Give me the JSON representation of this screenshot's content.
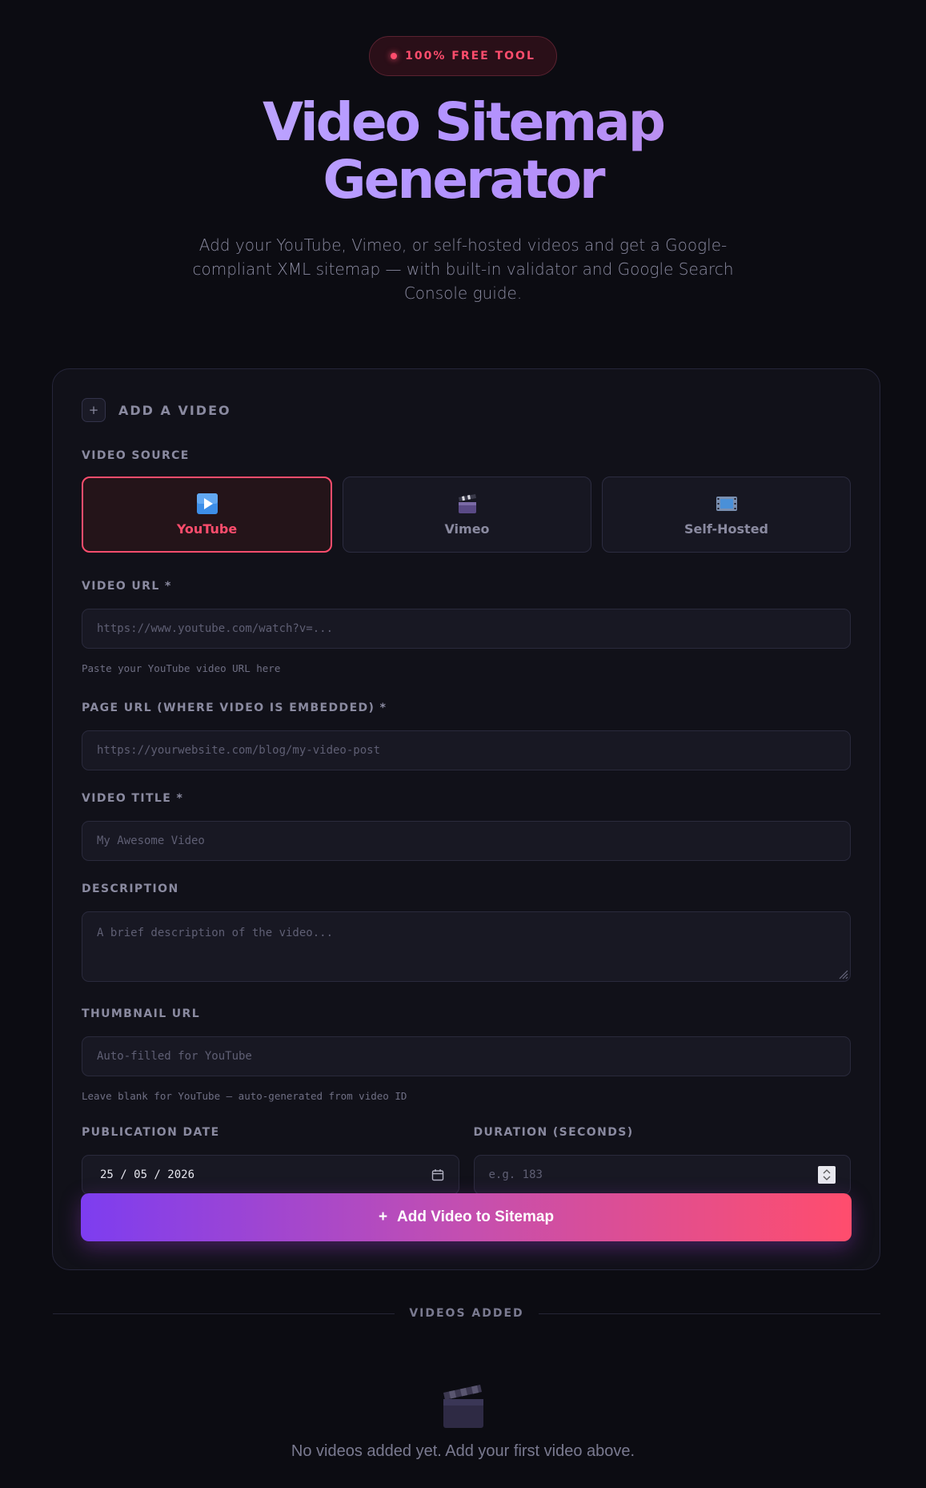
{
  "badge": {
    "text": "100% FREE TOOL"
  },
  "hero": {
    "title_line1": "Video Sitemap",
    "title_line2": "Generator",
    "subtitle": "Add your YouTube, Vimeo, or self-hosted videos and get a Google-compliant XML sitemap — with built-in validator and Google Search Console guide."
  },
  "form": {
    "heading": "ADD A VIDEO",
    "source_label": "VIDEO SOURCE",
    "sources": [
      {
        "name": "YouTube",
        "icon": "play-button-icon",
        "active": true
      },
      {
        "name": "Vimeo",
        "icon": "clapper-board-icon",
        "active": false
      },
      {
        "name": "Self-Hosted",
        "icon": "film-strip-icon",
        "active": false
      }
    ],
    "video_url": {
      "label": "VIDEO URL *",
      "placeholder": "https://www.youtube.com/watch?v=...",
      "hint": "Paste your YouTube video URL here"
    },
    "page_url": {
      "label": "PAGE URL (WHERE VIDEO IS EMBEDDED) *",
      "placeholder": "https://yourwebsite.com/blog/my-video-post"
    },
    "video_title": {
      "label": "VIDEO TITLE *",
      "placeholder": "My Awesome Video"
    },
    "description": {
      "label": "DESCRIPTION",
      "placeholder": "A brief description of the video..."
    },
    "thumbnail": {
      "label": "THUMBNAIL URL",
      "placeholder": "Auto-filled for YouTube",
      "hint": "Leave blank for YouTube — auto-generated from video ID"
    },
    "pub_date": {
      "label": "PUBLICATION DATE",
      "value": "25 / 05 / 2026"
    },
    "duration": {
      "label": "DURATION (SECONDS)",
      "placeholder": "e.g. 183"
    },
    "submit_label": "Add Video to Sitemap"
  },
  "videos": {
    "heading": "VIDEOS ADDED",
    "empty_message": "No videos added yet. Add your first video above."
  },
  "colors": {
    "accent": "#ff4d6d",
    "purple": "#7d3df0",
    "background": "#0c0c12"
  }
}
